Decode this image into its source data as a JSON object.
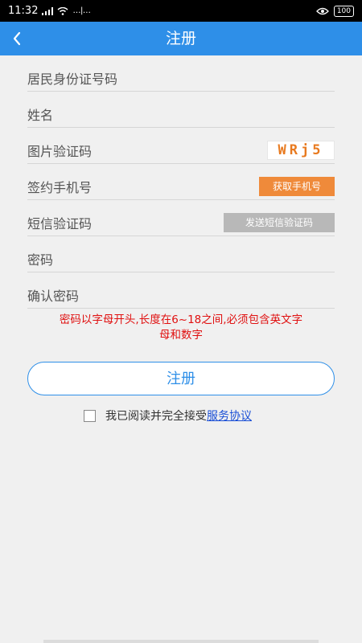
{
  "status_bar": {
    "time": "11:32",
    "indicators": "…|…",
    "battery": "100"
  },
  "header": {
    "back_icon": "chevron-left-icon",
    "title": "注册"
  },
  "form": {
    "id_number_placeholder": "居民身份证号码",
    "name_placeholder": "姓名",
    "captcha_placeholder": "图片验证码",
    "captcha_code": "WRj5",
    "phone_placeholder": "签约手机号",
    "get_phone_button": "获取手机号",
    "sms_placeholder": "短信验证码",
    "send_sms_button": "发送短信验证码",
    "password_placeholder": "密码",
    "confirm_password_placeholder": "确认密码"
  },
  "hint": {
    "line1": "密码以字母开头,长度在6~18之间,必须包含英文字",
    "line2": "母和数字"
  },
  "register_button": "注册",
  "agreement": {
    "text": "我已阅读并完全接受",
    "link": "服务协议"
  },
  "colors": {
    "primary": "#2e8fe8",
    "accent_orange": "#ef8a3a",
    "error_red": "#e01010",
    "link_blue": "#1a4fd6"
  }
}
